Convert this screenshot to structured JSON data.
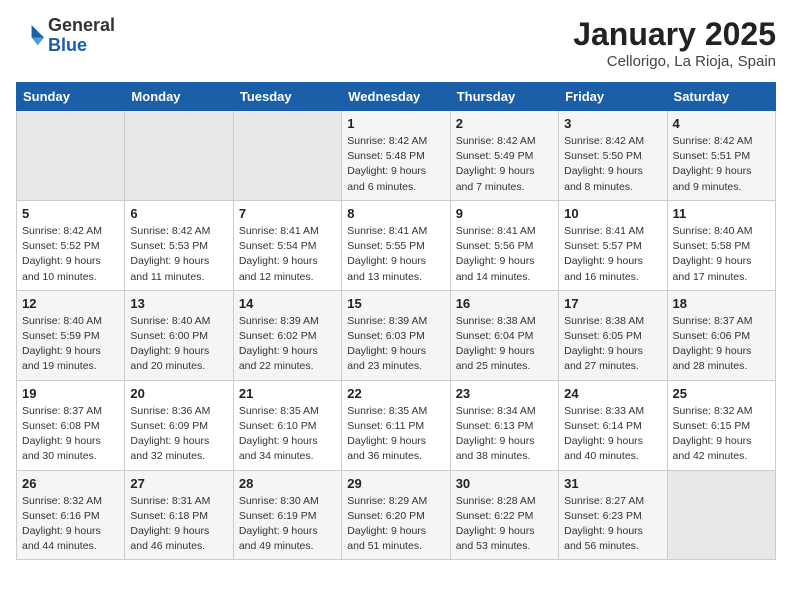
{
  "header": {
    "logo_general": "General",
    "logo_blue": "Blue",
    "month": "January 2025",
    "location": "Cellorigo, La Rioja, Spain"
  },
  "weekdays": [
    "Sunday",
    "Monday",
    "Tuesday",
    "Wednesday",
    "Thursday",
    "Friday",
    "Saturday"
  ],
  "weeks": [
    [
      {
        "day": "",
        "sunrise": "",
        "sunset": "",
        "daylight": ""
      },
      {
        "day": "",
        "sunrise": "",
        "sunset": "",
        "daylight": ""
      },
      {
        "day": "",
        "sunrise": "",
        "sunset": "",
        "daylight": ""
      },
      {
        "day": "1",
        "sunrise": "Sunrise: 8:42 AM",
        "sunset": "Sunset: 5:48 PM",
        "daylight": "Daylight: 9 hours and 6 minutes."
      },
      {
        "day": "2",
        "sunrise": "Sunrise: 8:42 AM",
        "sunset": "Sunset: 5:49 PM",
        "daylight": "Daylight: 9 hours and 7 minutes."
      },
      {
        "day": "3",
        "sunrise": "Sunrise: 8:42 AM",
        "sunset": "Sunset: 5:50 PM",
        "daylight": "Daylight: 9 hours and 8 minutes."
      },
      {
        "day": "4",
        "sunrise": "Sunrise: 8:42 AM",
        "sunset": "Sunset: 5:51 PM",
        "daylight": "Daylight: 9 hours and 9 minutes."
      }
    ],
    [
      {
        "day": "5",
        "sunrise": "Sunrise: 8:42 AM",
        "sunset": "Sunset: 5:52 PM",
        "daylight": "Daylight: 9 hours and 10 minutes."
      },
      {
        "day": "6",
        "sunrise": "Sunrise: 8:42 AM",
        "sunset": "Sunset: 5:53 PM",
        "daylight": "Daylight: 9 hours and 11 minutes."
      },
      {
        "day": "7",
        "sunrise": "Sunrise: 8:41 AM",
        "sunset": "Sunset: 5:54 PM",
        "daylight": "Daylight: 9 hours and 12 minutes."
      },
      {
        "day": "8",
        "sunrise": "Sunrise: 8:41 AM",
        "sunset": "Sunset: 5:55 PM",
        "daylight": "Daylight: 9 hours and 13 minutes."
      },
      {
        "day": "9",
        "sunrise": "Sunrise: 8:41 AM",
        "sunset": "Sunset: 5:56 PM",
        "daylight": "Daylight: 9 hours and 14 minutes."
      },
      {
        "day": "10",
        "sunrise": "Sunrise: 8:41 AM",
        "sunset": "Sunset: 5:57 PM",
        "daylight": "Daylight: 9 hours and 16 minutes."
      },
      {
        "day": "11",
        "sunrise": "Sunrise: 8:40 AM",
        "sunset": "Sunset: 5:58 PM",
        "daylight": "Daylight: 9 hours and 17 minutes."
      }
    ],
    [
      {
        "day": "12",
        "sunrise": "Sunrise: 8:40 AM",
        "sunset": "Sunset: 5:59 PM",
        "daylight": "Daylight: 9 hours and 19 minutes."
      },
      {
        "day": "13",
        "sunrise": "Sunrise: 8:40 AM",
        "sunset": "Sunset: 6:00 PM",
        "daylight": "Daylight: 9 hours and 20 minutes."
      },
      {
        "day": "14",
        "sunrise": "Sunrise: 8:39 AM",
        "sunset": "Sunset: 6:02 PM",
        "daylight": "Daylight: 9 hours and 22 minutes."
      },
      {
        "day": "15",
        "sunrise": "Sunrise: 8:39 AM",
        "sunset": "Sunset: 6:03 PM",
        "daylight": "Daylight: 9 hours and 23 minutes."
      },
      {
        "day": "16",
        "sunrise": "Sunrise: 8:38 AM",
        "sunset": "Sunset: 6:04 PM",
        "daylight": "Daylight: 9 hours and 25 minutes."
      },
      {
        "day": "17",
        "sunrise": "Sunrise: 8:38 AM",
        "sunset": "Sunset: 6:05 PM",
        "daylight": "Daylight: 9 hours and 27 minutes."
      },
      {
        "day": "18",
        "sunrise": "Sunrise: 8:37 AM",
        "sunset": "Sunset: 6:06 PM",
        "daylight": "Daylight: 9 hours and 28 minutes."
      }
    ],
    [
      {
        "day": "19",
        "sunrise": "Sunrise: 8:37 AM",
        "sunset": "Sunset: 6:08 PM",
        "daylight": "Daylight: 9 hours and 30 minutes."
      },
      {
        "day": "20",
        "sunrise": "Sunrise: 8:36 AM",
        "sunset": "Sunset: 6:09 PM",
        "daylight": "Daylight: 9 hours and 32 minutes."
      },
      {
        "day": "21",
        "sunrise": "Sunrise: 8:35 AM",
        "sunset": "Sunset: 6:10 PM",
        "daylight": "Daylight: 9 hours and 34 minutes."
      },
      {
        "day": "22",
        "sunrise": "Sunrise: 8:35 AM",
        "sunset": "Sunset: 6:11 PM",
        "daylight": "Daylight: 9 hours and 36 minutes."
      },
      {
        "day": "23",
        "sunrise": "Sunrise: 8:34 AM",
        "sunset": "Sunset: 6:13 PM",
        "daylight": "Daylight: 9 hours and 38 minutes."
      },
      {
        "day": "24",
        "sunrise": "Sunrise: 8:33 AM",
        "sunset": "Sunset: 6:14 PM",
        "daylight": "Daylight: 9 hours and 40 minutes."
      },
      {
        "day": "25",
        "sunrise": "Sunrise: 8:32 AM",
        "sunset": "Sunset: 6:15 PM",
        "daylight": "Daylight: 9 hours and 42 minutes."
      }
    ],
    [
      {
        "day": "26",
        "sunrise": "Sunrise: 8:32 AM",
        "sunset": "Sunset: 6:16 PM",
        "daylight": "Daylight: 9 hours and 44 minutes."
      },
      {
        "day": "27",
        "sunrise": "Sunrise: 8:31 AM",
        "sunset": "Sunset: 6:18 PM",
        "daylight": "Daylight: 9 hours and 46 minutes."
      },
      {
        "day": "28",
        "sunrise": "Sunrise: 8:30 AM",
        "sunset": "Sunset: 6:19 PM",
        "daylight": "Daylight: 9 hours and 49 minutes."
      },
      {
        "day": "29",
        "sunrise": "Sunrise: 8:29 AM",
        "sunset": "Sunset: 6:20 PM",
        "daylight": "Daylight: 9 hours and 51 minutes."
      },
      {
        "day": "30",
        "sunrise": "Sunrise: 8:28 AM",
        "sunset": "Sunset: 6:22 PM",
        "daylight": "Daylight: 9 hours and 53 minutes."
      },
      {
        "day": "31",
        "sunrise": "Sunrise: 8:27 AM",
        "sunset": "Sunset: 6:23 PM",
        "daylight": "Daylight: 9 hours and 56 minutes."
      },
      {
        "day": "",
        "sunrise": "",
        "sunset": "",
        "daylight": ""
      }
    ]
  ]
}
